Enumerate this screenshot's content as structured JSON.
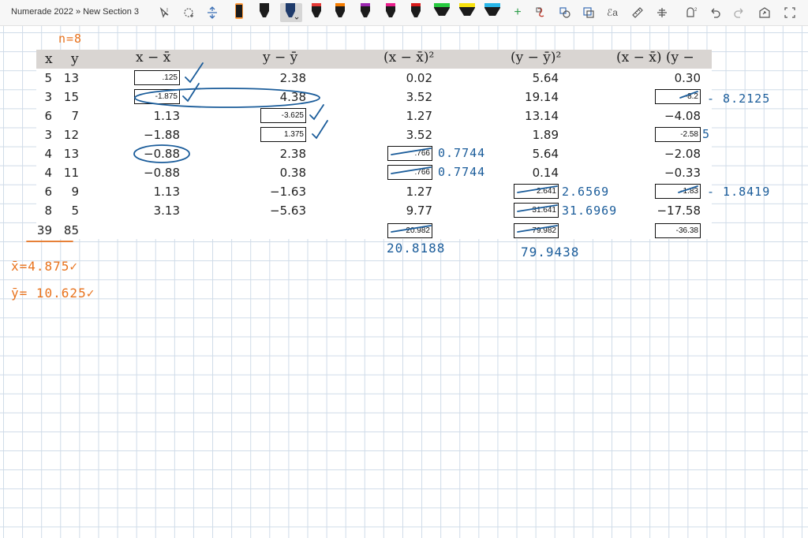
{
  "toolbar": {
    "breadcrumb": "Numerade 2022 » New Section 3",
    "tools": [
      "lasso-select-icon",
      "add-space-icon",
      "insert-space-icon",
      "pen-black-icon",
      "pen-black-2-icon",
      "pen-navy-icon",
      "pen-red-icon",
      "pen-orange-icon",
      "pen-purple-icon",
      "pen-pink-icon",
      "pen-red-2-icon",
      "highlighter-green-icon",
      "highlighter-yellow-icon",
      "highlighter-cyan-icon",
      "add-pen-icon",
      "ink-to-shape-icon",
      "ink-to-text-icon",
      "ink-to-math-icon",
      "ink-replay-icon",
      "ruler-icon",
      "rotate-icon",
      "eraser-options-icon",
      "undo-icon",
      "redo-icon",
      "share-icon",
      "fullscreen-icon"
    ],
    "colors": {
      "black": "#1b1b1b",
      "navy": "#1f3b6b",
      "red": "#e53935",
      "orange": "#f57c00",
      "purple": "#9c27b0",
      "pink": "#e91e8c",
      "red2": "#d81b1b",
      "green": "#27c93f",
      "yellow": "#f6e00d",
      "cyan": "#29b6e8"
    }
  },
  "table": {
    "headers": [
      "x",
      "y",
      "x − x̄",
      "y − ȳ",
      "(x − x̄)²",
      "(y − ȳ)²",
      "(x − x̄) (y −"
    ],
    "rows": [
      [
        "5",
        "13",
        "",
        "2.38",
        "0.02",
        "5.64",
        "0.30"
      ],
      [
        "3",
        "15",
        "",
        "",
        "3.52",
        "19.14",
        ""
      ],
      [
        "6",
        "7",
        "1.13",
        "",
        "1.27",
        "13.14",
        "−4.08"
      ],
      [
        "3",
        "12",
        "−1.88",
        "",
        "3.52",
        "1.89",
        ""
      ],
      [
        "4",
        "13",
        "−0.88",
        "2.38",
        "",
        "5.64",
        "−2.08"
      ],
      [
        "4",
        "11",
        "−0.88",
        "0.38",
        "",
        "0.14",
        "−0.33"
      ],
      [
        "6",
        "9",
        "1.13",
        "−1.63",
        "1.27",
        "",
        "−1.83"
      ],
      [
        "8",
        "5",
        "3.13",
        "−5.63",
        "9.77",
        "",
        "−17.58"
      ]
    ],
    "totals": {
      "x": "39",
      "y": "85"
    }
  },
  "boxes": {
    "b1": ".125",
    "b2": "-1.875",
    "b3": "4.38",
    "b4": "-3.625",
    "b5": "1.375",
    "b6": ".766",
    "b7": ".766",
    "b8": "20.982",
    "b9": "2.641",
    "b10": "31.641",
    "b11": "79.982",
    "b12": "-8.2",
    "b13": "-2.58",
    "b14": "-1.83",
    "b15": "-36.38"
  },
  "handwriting": {
    "n": "n=8",
    "xbar": "x̄=4.875✓",
    "ybar": "ȳ= 10.625✓",
    "sq1": "0.7744",
    "sq2": "0.7744",
    "sum_xx": "20.8188",
    "sq3": "2.6569",
    "sq4": "31.6969",
    "sum_yy": "79.9438",
    "prod1": "- 8.2125",
    "prod2": "5",
    "prod3": "- 1.8419"
  }
}
